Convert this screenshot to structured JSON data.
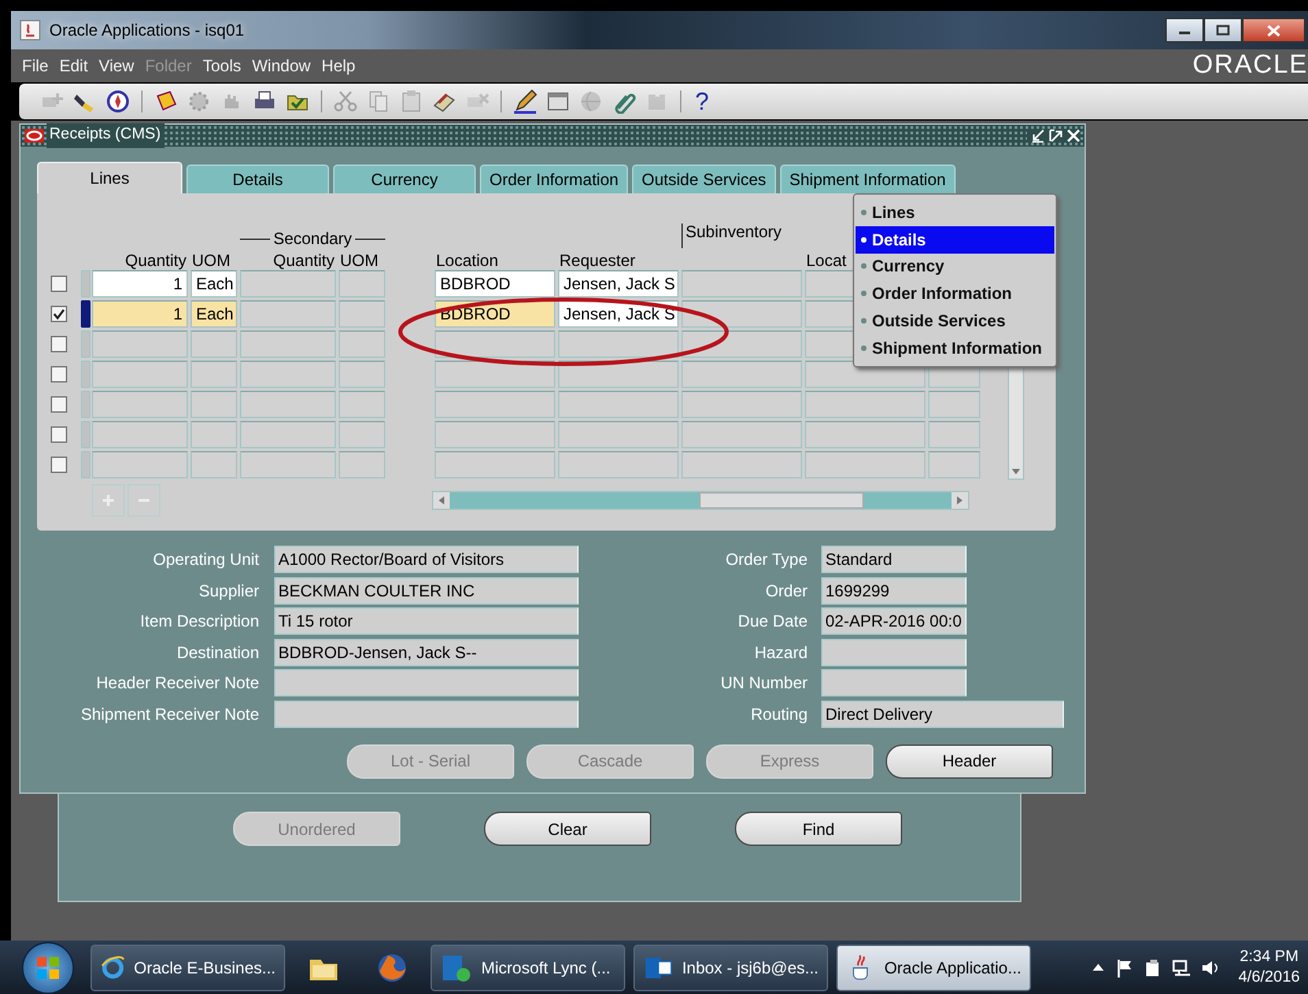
{
  "window": {
    "title": "Oracle Applications - isq01"
  },
  "menu": [
    {
      "label": "File",
      "disabled": false
    },
    {
      "label": "Edit",
      "disabled": false
    },
    {
      "label": "View",
      "disabled": false
    },
    {
      "label": "Folder",
      "disabled": true
    },
    {
      "label": "Tools",
      "disabled": false
    },
    {
      "label": "Window",
      "disabled": false
    },
    {
      "label": "Help",
      "disabled": false
    }
  ],
  "brand": "ORACLE",
  "toolbar": [
    {
      "kind": "new",
      "disabled": true
    },
    {
      "kind": "find",
      "disabled": false
    },
    {
      "kind": "navigator",
      "disabled": false
    },
    {
      "kind": "separator"
    },
    {
      "kind": "save",
      "disabled": false
    },
    {
      "kind": "next",
      "disabled": true
    },
    {
      "kind": "switch",
      "disabled": true
    },
    {
      "kind": "print",
      "disabled": false
    },
    {
      "kind": "close",
      "disabled": false
    },
    {
      "kind": "separator"
    },
    {
      "kind": "cut",
      "disabled": true
    },
    {
      "kind": "copy",
      "disabled": true
    },
    {
      "kind": "paste",
      "disabled": true
    },
    {
      "kind": "clear",
      "disabled": false
    },
    {
      "kind": "delete",
      "disabled": true
    },
    {
      "kind": "separator"
    },
    {
      "kind": "edit",
      "disabled": false
    },
    {
      "kind": "zoom",
      "disabled": false
    },
    {
      "kind": "translate",
      "disabled": true
    },
    {
      "kind": "attach",
      "disabled": false
    },
    {
      "kind": "folder_tools",
      "disabled": true
    },
    {
      "kind": "separator"
    },
    {
      "kind": "help",
      "label": "?",
      "disabled": false
    }
  ],
  "form": {
    "title": "Receipts (CMS)",
    "tabs": [
      {
        "label": "Lines",
        "selected": true
      },
      {
        "label": "Details",
        "selected": false
      },
      {
        "label": "Currency",
        "selected": false
      },
      {
        "label": "Order Information",
        "selected": false
      },
      {
        "label": "Outside Services",
        "selected": false
      },
      {
        "label": "Shipment Information",
        "selected": false
      }
    ],
    "table": {
      "secondary_heading": "Secondary",
      "columns": [
        {
          "kind": "text",
          "label": "Quantity",
          "required": true
        },
        {
          "kind": "text",
          "label": "UOM",
          "required": true
        },
        {
          "kind": "text",
          "label": "Quantity"
        },
        {
          "kind": "text",
          "label": "UOM"
        },
        {
          "kind": "text",
          "label": "Location",
          "required": true
        },
        {
          "kind": "text",
          "label": "Requester",
          "required": false
        },
        {
          "kind": "text",
          "label": "Subinventory",
          "raised": true
        },
        {
          "kind": "text",
          "label": "Locat"
        },
        {
          "kind": "blank"
        }
      ],
      "rows": [
        {
          "checked": false,
          "current": false,
          "quantity": "1",
          "uom": "Each",
          "location": "BDBROD",
          "requester": "Jensen, Jack S"
        },
        {
          "checked": true,
          "current": true,
          "quantity": "1",
          "uom": "Each",
          "location": "BDBROD",
          "requester": "Jensen, Jack S"
        },
        {
          "checked": false,
          "current": false
        },
        {
          "checked": false,
          "current": false
        },
        {
          "checked": false,
          "current": false
        },
        {
          "checked": false,
          "current": false
        },
        {
          "checked": false,
          "current": false
        }
      ]
    },
    "tab_menu": [
      {
        "label": "Lines",
        "selected": false
      },
      {
        "label": "Details",
        "selected": true
      },
      {
        "label": "Currency",
        "selected": false
      },
      {
        "label": "Order Information",
        "selected": false
      },
      {
        "label": "Outside Services",
        "selected": false
      },
      {
        "label": "Shipment Information",
        "selected": false
      }
    ],
    "fields_left": [
      {
        "label": "Operating Unit",
        "value": "A1000 Rector/Board of Visitors"
      },
      {
        "label": "Supplier",
        "value": "BECKMAN COULTER INC"
      },
      {
        "label": "Item Description",
        "value": "Ti 15 rotor"
      },
      {
        "label": "Destination",
        "value": "BDBROD-Jensen, Jack S--"
      },
      {
        "label": "Header Receiver Note"
      },
      {
        "label": "Shipment Receiver Note"
      }
    ],
    "fields_right": [
      {
        "label": "Order Type",
        "value": "Standard"
      },
      {
        "label": "Order",
        "value": "1699299"
      },
      {
        "label": "Due Date",
        "value": "02-APR-2016 00:0"
      },
      {
        "label": "Hazard"
      },
      {
        "label": "UN Number"
      },
      {
        "label": "Routing",
        "value": "Direct Delivery"
      }
    ],
    "buttons": [
      {
        "label": "Lot - Serial",
        "disabled": true
      },
      {
        "label": "Cascade",
        "disabled": true
      },
      {
        "label": "Express",
        "disabled": true
      },
      {
        "label": "Header",
        "disabled": false
      }
    ]
  },
  "find_window": {
    "buttons": [
      {
        "label": "Unordered",
        "disabled": true
      },
      {
        "label": "Clear",
        "disabled": false
      },
      {
        "label": "Find",
        "disabled": false
      }
    ]
  },
  "taskbar": {
    "items": [
      {
        "kind": "browser",
        "label": "Oracle E-Busines...",
        "selected": false
      },
      {
        "kind": "folder",
        "selected": false
      },
      {
        "kind": "firefox",
        "selected": false
      },
      {
        "kind": "lync",
        "label": "Microsoft Lync  (...",
        "selected": false
      },
      {
        "kind": "mail",
        "label": "Inbox - jsj6b@es...",
        "selected": false
      },
      {
        "kind": "java",
        "label": "Oracle Applicatio...",
        "selected": true
      }
    ],
    "time": "2:34 PM",
    "date": "4/6/2016"
  }
}
